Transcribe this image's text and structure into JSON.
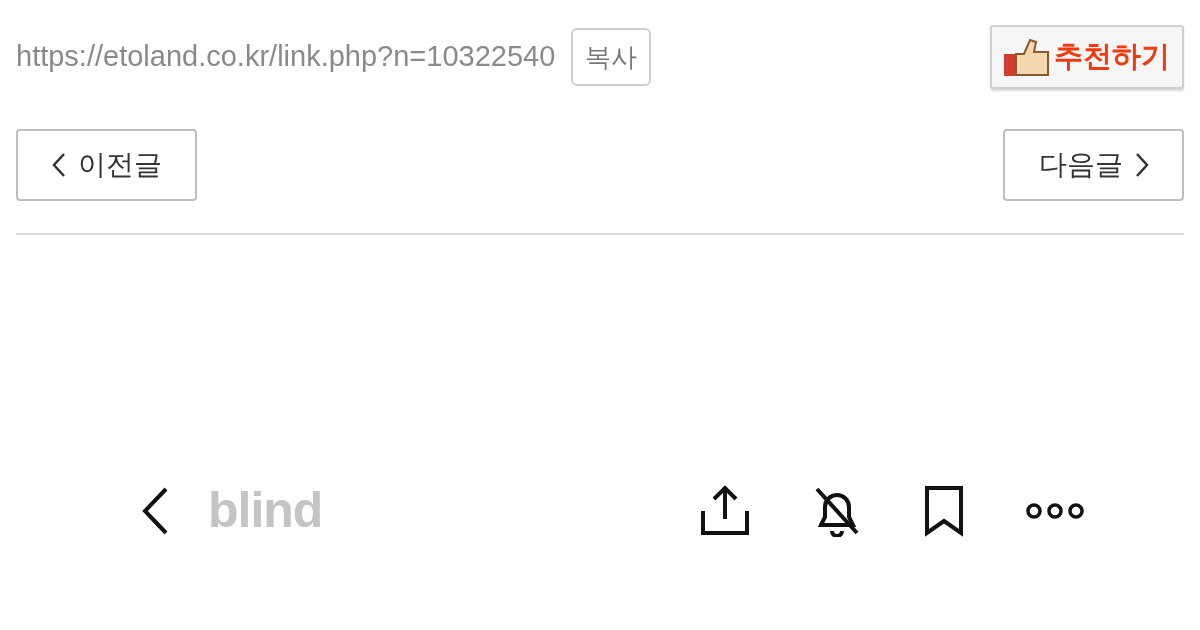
{
  "share": {
    "url": "https://etoland.co.kr/link.php?n=10322540",
    "copy_button": "복사",
    "recommend_button": "추천하기"
  },
  "navigation": {
    "previous": "이전글",
    "next": "다음글"
  },
  "embedded_app": {
    "logo": "blind"
  }
}
